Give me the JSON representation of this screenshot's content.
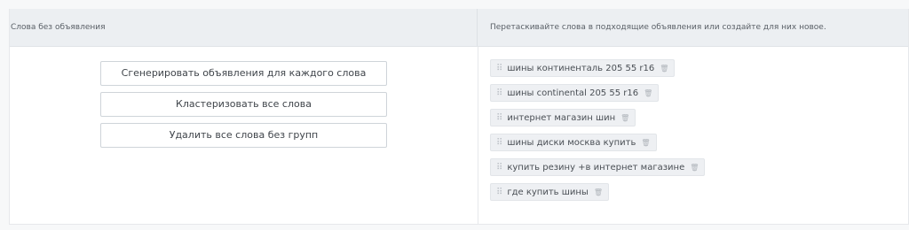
{
  "header": {
    "left_title": "Слова без объявления",
    "right_hint": "Перетаскивайте слова в подходящие объявления или создайте для них новое."
  },
  "actions": [
    {
      "label": "Сгенерировать объявления для каждого слова"
    },
    {
      "label": "Кластеризовать все слова"
    },
    {
      "label": "Удалить все слова без групп"
    }
  ],
  "words": [
    {
      "text": "шины континенталь 205 55 r16"
    },
    {
      "text": "шины continental 205 55 r16"
    },
    {
      "text": "интернет магазин шин"
    },
    {
      "text": "шины диски москва купить"
    },
    {
      "text": "купить резину +в интернет магазине"
    },
    {
      "text": "где купить шины"
    }
  ],
  "icons": {
    "drag": "drag-handle-icon",
    "delete": "trash-icon"
  }
}
